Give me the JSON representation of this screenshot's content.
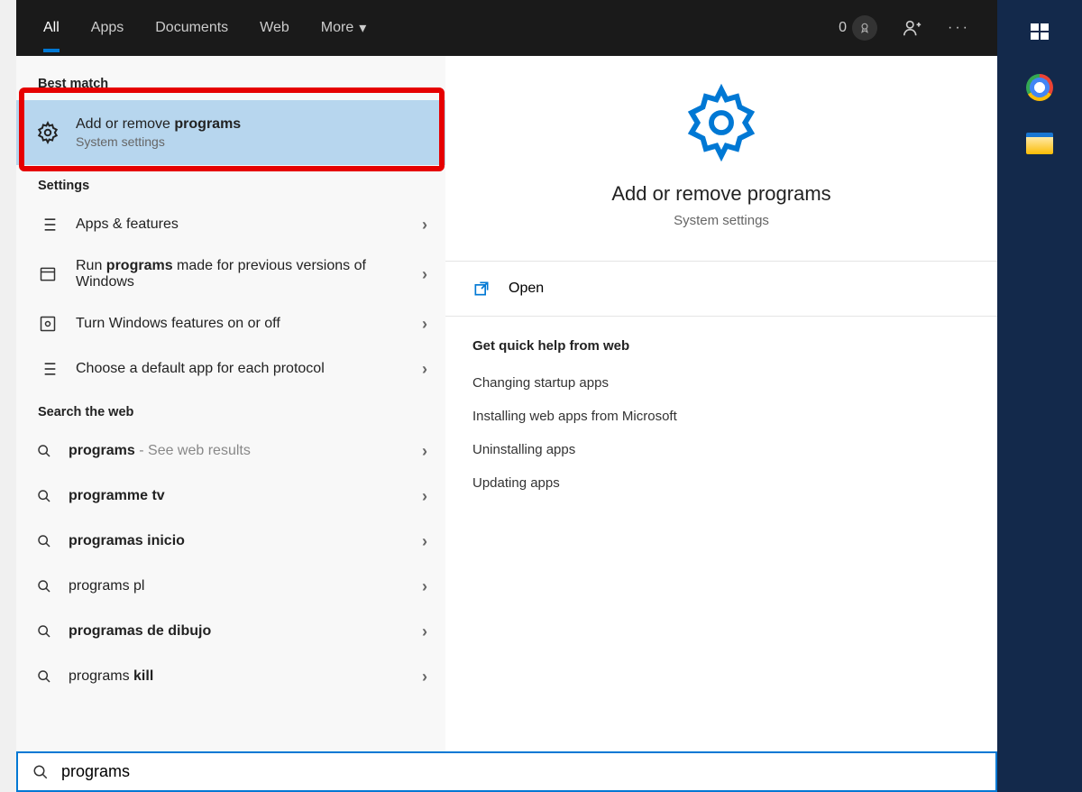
{
  "tabs": {
    "all": "All",
    "apps": "Apps",
    "documents": "Documents",
    "web": "Web",
    "more": "More"
  },
  "tabs_right": {
    "count": "0"
  },
  "sections": {
    "best_match": "Best match",
    "settings": "Settings",
    "search_web": "Search the web"
  },
  "best": {
    "title_prefix": "Add or remove ",
    "title_bold": "programs",
    "subtitle": "System settings"
  },
  "settings_results": [
    {
      "title": "Apps & features"
    },
    {
      "title_prefix": "Run ",
      "title_bold": "programs",
      "title_suffix": " made for previous versions of Windows"
    },
    {
      "title": "Turn Windows features on or off"
    },
    {
      "title": "Choose a default app for each protocol"
    }
  ],
  "web_results": [
    {
      "bold": "programs",
      "suffix": " - See web results"
    },
    {
      "bold": "programme tv"
    },
    {
      "bold": "programas inicio"
    },
    {
      "plain": "programs pl"
    },
    {
      "bold": "programas de dibujo"
    },
    {
      "plain": "programs ",
      "bold": "kill"
    }
  ],
  "preview": {
    "title": "Add or remove programs",
    "subtitle": "System settings",
    "open": "Open",
    "help_header": "Get quick help from web",
    "links": [
      "Changing startup apps",
      "Installing web apps from Microsoft",
      "Uninstalling apps",
      "Updating apps"
    ]
  },
  "search_input": "programs"
}
